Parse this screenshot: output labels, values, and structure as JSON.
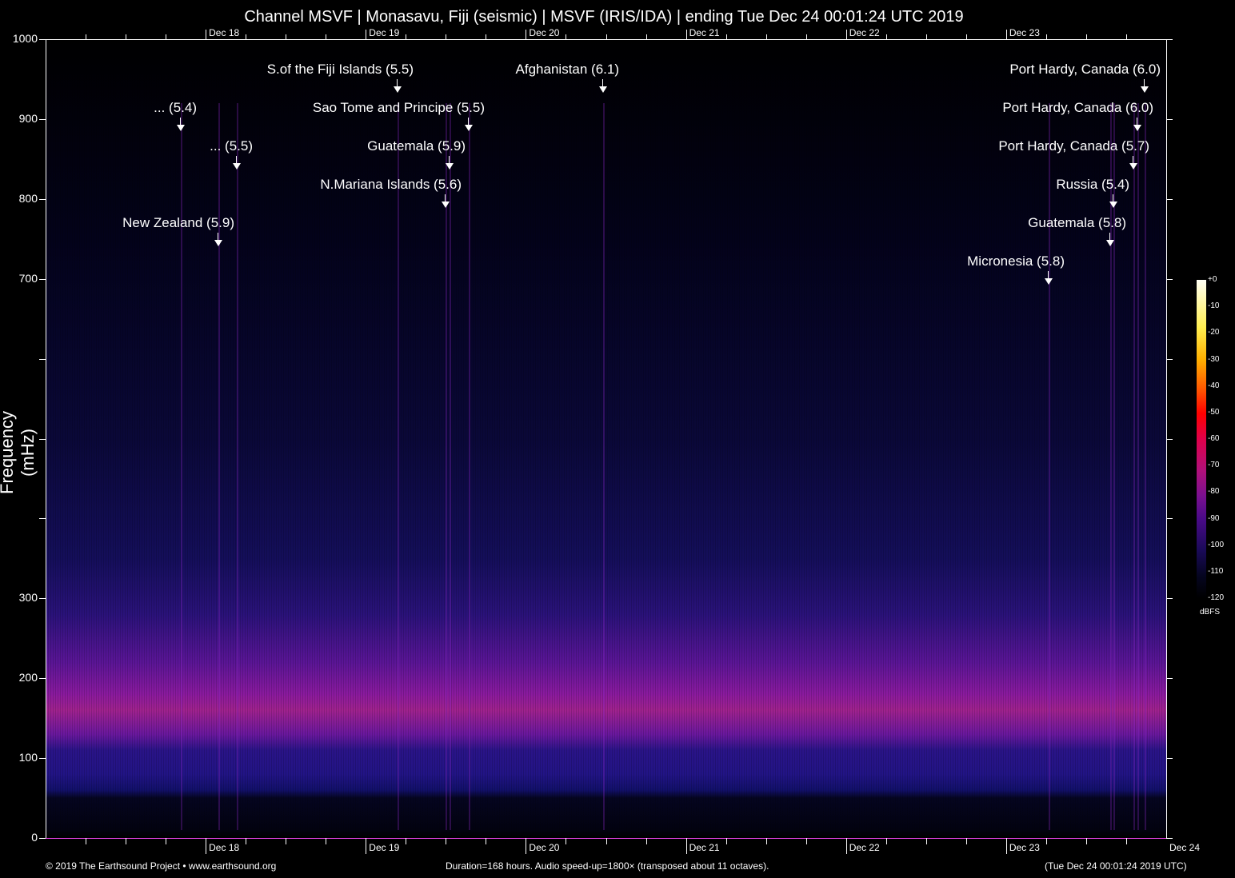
{
  "chart_data": {
    "type": "heatmap",
    "title": "Channel MSVF | Monasavu, Fiji (seismic) | MSVF (IRIS/IDA) | ending Tue Dec 24 00:01:24 UTC 2019",
    "ylabel": "Frequency (mHz)",
    "ylim": [
      0,
      1000
    ],
    "yticks": [
      0,
      100,
      200,
      300,
      400,
      500,
      600,
      700,
      800,
      900,
      1000
    ],
    "ytick_labels": [
      "0",
      "100",
      "200",
      "300",
      "",
      "",
      "",
      "700",
      "800",
      "900",
      "1000"
    ],
    "xlim_hours": [
      0,
      168
    ],
    "xtick_labels": [
      "Dec 18",
      "Dec 19",
      "Dec 20",
      "Dec 21",
      "Dec 22",
      "Dec 23"
    ],
    "xtick_hours": [
      24,
      48,
      72,
      96,
      120,
      144
    ],
    "x_end_label": "Dec 24",
    "colorbar": {
      "unit": "dBFS",
      "labels": [
        "+0",
        "-10",
        "-20",
        "-30",
        "-40",
        "-50",
        "-60",
        "-70",
        "-80",
        "-90",
        "-100",
        "-110",
        "-120"
      ]
    },
    "events": [
      {
        "label": "S.of the Fiji Islands (5.5)",
        "hour": 52.8
      },
      {
        "label": "Afghanistan (6.1)",
        "hour": 83.6
      },
      {
        "label": "... (5.4)",
        "hour": 20.3
      },
      {
        "label": "Sao Tome and Principe (5.5)",
        "hour": 63.4
      },
      {
        "label": "... (5.5)",
        "hour": 28.7
      },
      {
        "label": "Guatemala (5.9)",
        "hour": 60.5
      },
      {
        "label": "N.Mariana Islands (5.6)",
        "hour": 59.9
      },
      {
        "label": "New Zealand (5.9)",
        "hour": 25.9
      },
      {
        "label": "Port Hardy, Canada (6.0)",
        "hour": 164.8
      },
      {
        "label": "Port Hardy, Canada (6.0)",
        "hour": 163.7
      },
      {
        "label": "Port Hardy, Canada (5.7)",
        "hour": 163.1
      },
      {
        "label": "Russia (5.4)",
        "hour": 160.1
      },
      {
        "label": "Guatemala (5.8)",
        "hour": 159.6
      },
      {
        "label": "Micronesia (5.8)",
        "hour": 150.4
      }
    ]
  },
  "footer": {
    "copyright": "© 2019 The Earthsound Project • www.earthsound.org",
    "info": "Duration=168 hours. Audio speed-up=1800× (transposed about 11 octaves).",
    "end_time": "(Tue Dec 24 00:01:24 2019 UTC)"
  }
}
